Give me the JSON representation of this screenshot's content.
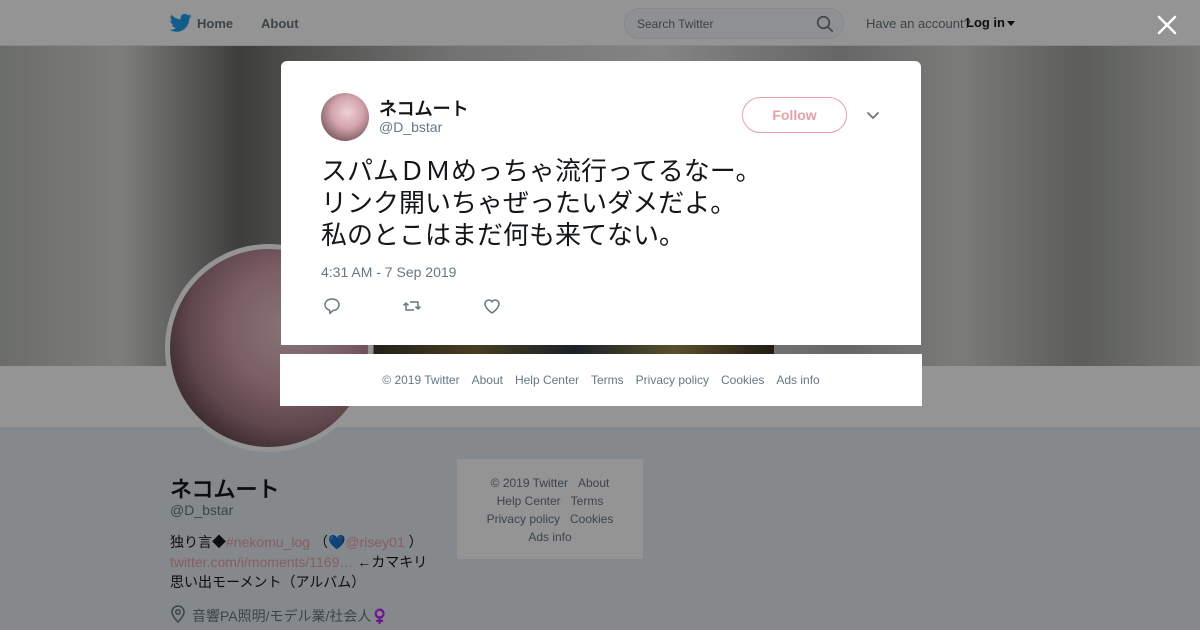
{
  "topbar": {
    "home_label": "Home",
    "about_label": "About",
    "search_placeholder": "Search Twitter",
    "account_prompt": "Have an account?",
    "login_label": "Log in"
  },
  "profile": {
    "name": "ネコムート",
    "handle": "@D_bstar",
    "bio_prefix": "独り言◆",
    "bio_hashtag": "#nekomu_log",
    "bio_paren_open": "（",
    "bio_heart": "💙",
    "bio_mention": "@risey01",
    "bio_paren_close": "）",
    "bio_link": "twitter.com/i/moments/1169…",
    "bio_link_suffix": "←カマキリ",
    "bio_line3": "思い出モーメント（アルバム）",
    "location": "音響PA照明/モデル業/社会人♀️"
  },
  "sidebar_footer": {
    "items": [
      "© 2019 Twitter",
      "About",
      "Help Center",
      "Terms",
      "Privacy policy",
      "Cookies",
      "Ads info"
    ]
  },
  "tweet": {
    "name": "ネコムート",
    "handle": "@D_bstar",
    "follow_label": "Follow",
    "text": "スパムＤＭめっちゃ流行ってるなー。\nリンク開いちゃぜったいダメだよ。\n私のとこはまだ何も来てない。",
    "timestamp": "4:31 AM - 7 Sep 2019"
  },
  "modal_footer": {
    "items": [
      "© 2019 Twitter",
      "About",
      "Help Center",
      "Terms",
      "Privacy policy",
      "Cookies",
      "Ads info"
    ]
  },
  "colors": {
    "accent": "#e8a0a8",
    "twitter_blue": "#1da1f2",
    "muted_text": "#657786"
  }
}
